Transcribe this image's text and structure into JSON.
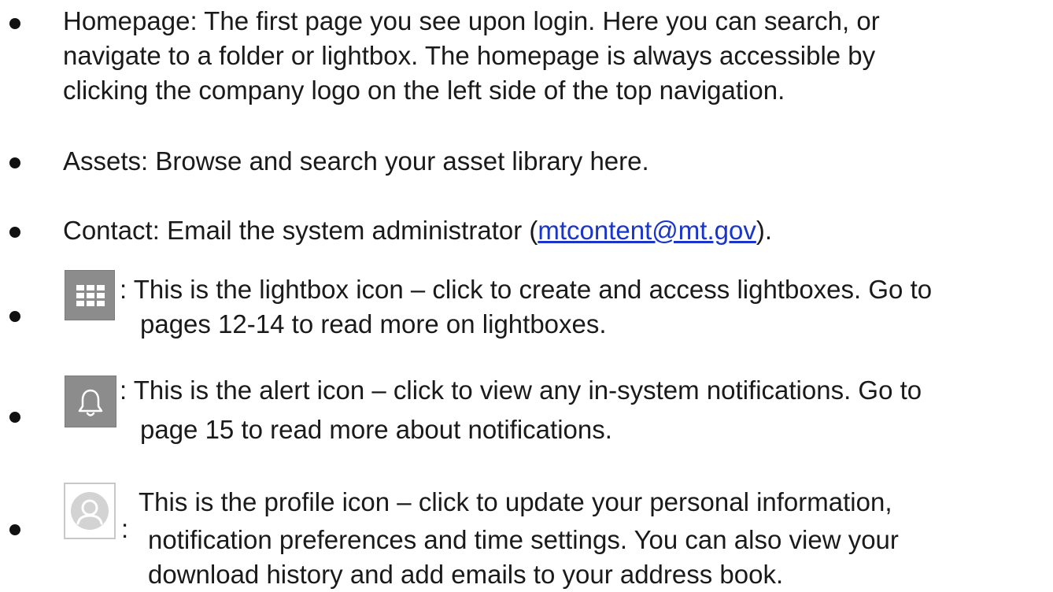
{
  "items": [
    {
      "lines": [
        "Homepage: The first page you see upon login. Here you can search,  or",
        "navigate to a folder or lightbox. The  homepage is always accessible by",
        "clicking the company logo on the left  side of the top navigation."
      ]
    },
    {
      "lines": [
        "Assets: Browse and search your asset library here."
      ]
    },
    {
      "prefix": "Contact: Email the system administrator (",
      "email": "mtcontent@mt.gov",
      "suffix": ")."
    },
    {
      "icon": "lightbox-grid-icon",
      "lines": [
        ": This is the lightbox icon – click to create and access lightboxes. Go to",
        "pages 12-14 to read more on lightboxes."
      ]
    },
    {
      "icon": "bell-icon",
      "lines": [
        ": This is the alert icon – click to view any in-system notifications. Go to",
        "page 15 to read more about notifications."
      ]
    },
    {
      "icon": "profile-avatar-icon",
      "colon": ":",
      "lines": [
        "This is the profile icon – click to update your personal information,",
        "notification preferences and time settings. You can also view your",
        "download history and add emails to your address book."
      ]
    }
  ],
  "colors": {
    "text": "#1a1a1a",
    "link": "#1a35c8",
    "icon_bg": "#8c8c8c"
  }
}
